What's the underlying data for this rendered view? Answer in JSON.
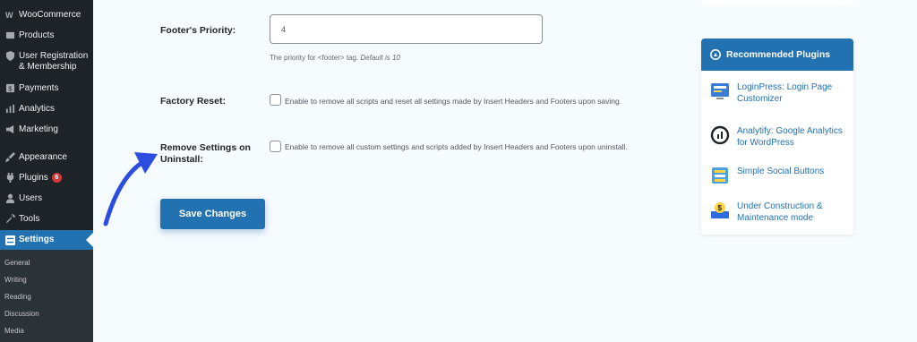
{
  "sidebar": {
    "items": [
      {
        "label": "WooCommerce",
        "icon": "woocommerce-icon"
      },
      {
        "label": "Products",
        "icon": "products-icon"
      },
      {
        "label": "User Registration & Membership",
        "icon": "shield-icon"
      },
      {
        "label": "Payments",
        "icon": "payments-icon"
      },
      {
        "label": "Analytics",
        "icon": "analytics-icon"
      },
      {
        "label": "Marketing",
        "icon": "megaphone-icon"
      },
      {
        "label": "Appearance",
        "icon": "paintbrush-icon"
      },
      {
        "label": "Plugins",
        "icon": "plugin-icon",
        "badge": "6"
      },
      {
        "label": "Users",
        "icon": "users-icon"
      },
      {
        "label": "Tools",
        "icon": "wrench-icon"
      },
      {
        "label": "Settings",
        "icon": "settings-icon"
      }
    ],
    "submenu": [
      "General",
      "Writing",
      "Reading",
      "Discussion",
      "Media"
    ]
  },
  "settings": {
    "footer_priority": {
      "label": "Footer's Priority:",
      "value": "4",
      "help_prefix": "The priority for <footer> tag.",
      "help_default": "Default is 10"
    },
    "factory_reset": {
      "label": "Factory Reset:",
      "text": "Enable to remove all scripts and reset all settings made by Insert Headers and Footers upon saving."
    },
    "remove_on_uninstall": {
      "label": "Remove Settings on Uninstall:",
      "text": "Enable to remove all custom settings and scripts added by Insert Headers and Footers upon uninstall."
    },
    "save_label": "Save Changes"
  },
  "recommended": {
    "title": "Recommended Plugins",
    "plugins": [
      {
        "name": "LoginPress: Login Page Customizer",
        "icon": "loginpress-icon"
      },
      {
        "name": "Analytify: Google Analytics for WordPress",
        "icon": "analytify-icon"
      },
      {
        "name": "Simple Social Buttons",
        "icon": "social-buttons-icon"
      },
      {
        "name": "Under Construction & Maintenance mode",
        "icon": "under-construction-icon"
      }
    ]
  },
  "colors": {
    "sidebar_bg": "#1d2327",
    "accent": "#2271b1",
    "badge": "#d63638",
    "annotation_arrow": "#2b4de0"
  }
}
